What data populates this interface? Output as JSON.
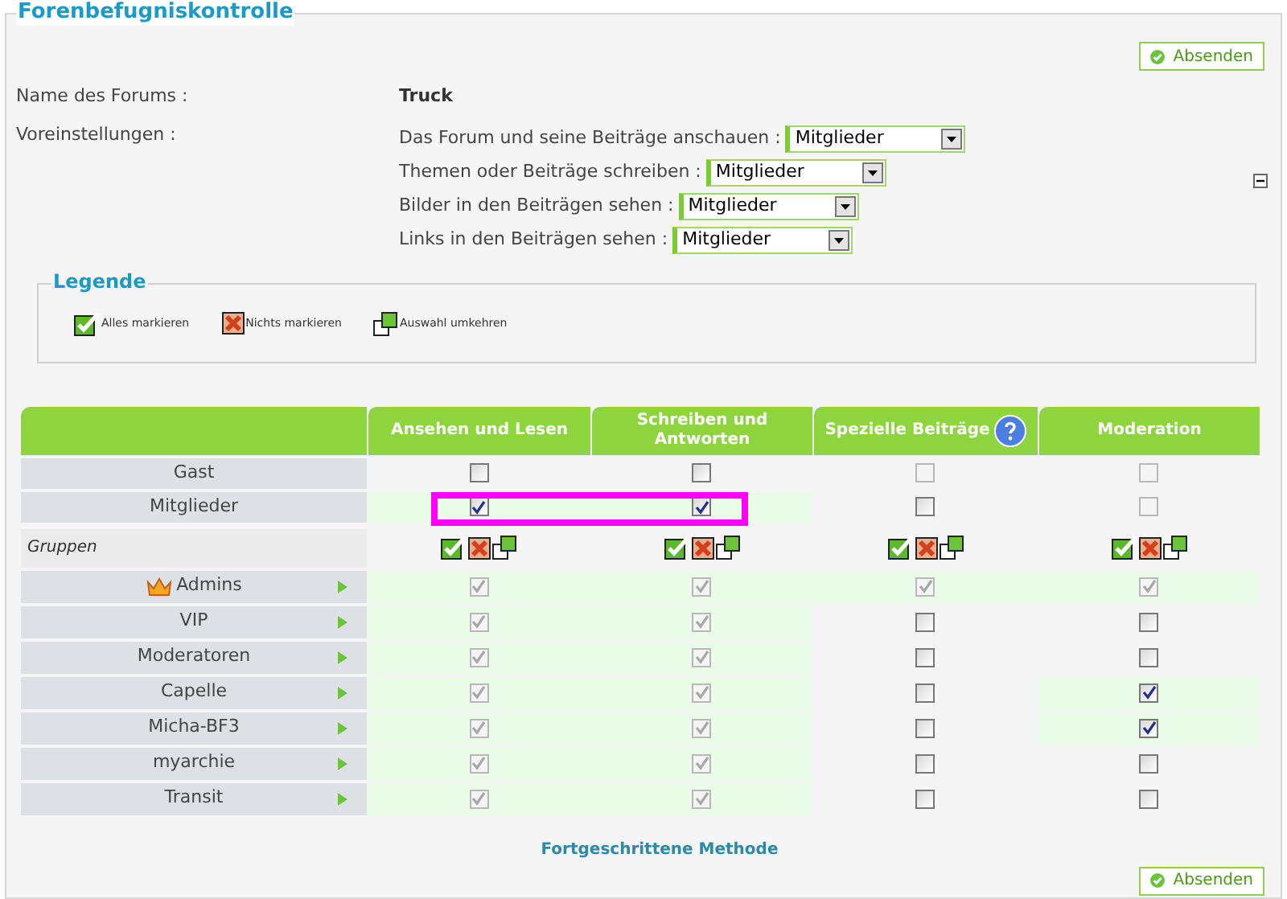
{
  "title": "Forenbefugniskontrolle",
  "submit_top": "Absenden",
  "forum_name": {
    "label": "Name des Forums :",
    "value": "Truck"
  },
  "presets": {
    "label": "Voreinstellungen :",
    "items": [
      {
        "label": "Das Forum und seine Beiträge anschauen :",
        "value": "Mitglieder"
      },
      {
        "label": "Themen oder Beiträge schreiben :",
        "value": "Mitglieder"
      },
      {
        "label": "Bilder in den Beiträgen sehen :",
        "value": "Mitglieder"
      },
      {
        "label": "Links in den Beiträgen sehen :",
        "value": "Mitglieder"
      }
    ]
  },
  "legend": {
    "title": "Legende",
    "items": [
      {
        "kind": "all",
        "label": "Alles markieren"
      },
      {
        "kind": "none",
        "label": "Nichts markieren"
      },
      {
        "kind": "invert",
        "label": "Auswahl umkehren"
      }
    ]
  },
  "table": {
    "columns": [
      {
        "label": "Ansehen und Lesen",
        "help": false
      },
      {
        "label": "Schreiben und Antworten",
        "help": false
      },
      {
        "label": "Spezielle Beiträge",
        "help": true
      },
      {
        "label": "Moderation",
        "help": false
      }
    ],
    "rows": [
      {
        "kind": "user",
        "label": "Gast",
        "highlighted": false,
        "cells": [
          {
            "checked": false,
            "disabled": false
          },
          {
            "checked": false,
            "disabled": false
          },
          {
            "checked": false,
            "disabled": true
          },
          {
            "checked": false,
            "disabled": true
          }
        ]
      },
      {
        "kind": "user",
        "label": "Mitglieder",
        "highlighted": true,
        "cells": [
          {
            "checked": true,
            "disabled": false
          },
          {
            "checked": true,
            "disabled": false
          },
          {
            "checked": false,
            "disabled": false
          },
          {
            "checked": false,
            "disabled": true
          }
        ]
      },
      {
        "kind": "section",
        "label": "Gruppen"
      },
      {
        "kind": "group",
        "label": "Admins",
        "crown": true,
        "highlighted": false,
        "cells": [
          {
            "checked": true,
            "disabled": true
          },
          {
            "checked": true,
            "disabled": true
          },
          {
            "checked": true,
            "disabled": true
          },
          {
            "checked": true,
            "disabled": true
          }
        ]
      },
      {
        "kind": "group",
        "label": "VIP",
        "crown": false,
        "highlighted": false,
        "cells": [
          {
            "checked": true,
            "disabled": true
          },
          {
            "checked": true,
            "disabled": true
          },
          {
            "checked": false,
            "disabled": false
          },
          {
            "checked": false,
            "disabled": false
          }
        ]
      },
      {
        "kind": "group",
        "label": "Moderatoren",
        "crown": false,
        "highlighted": false,
        "cells": [
          {
            "checked": true,
            "disabled": true
          },
          {
            "checked": true,
            "disabled": true
          },
          {
            "checked": false,
            "disabled": false
          },
          {
            "checked": false,
            "disabled": false
          }
        ]
      },
      {
        "kind": "group",
        "label": "Capelle",
        "crown": false,
        "highlighted": false,
        "cells": [
          {
            "checked": true,
            "disabled": true
          },
          {
            "checked": true,
            "disabled": true
          },
          {
            "checked": false,
            "disabled": false
          },
          {
            "checked": true,
            "disabled": false
          }
        ]
      },
      {
        "kind": "group",
        "label": "Micha-BF3",
        "crown": false,
        "highlighted": false,
        "cells": [
          {
            "checked": true,
            "disabled": true
          },
          {
            "checked": true,
            "disabled": true
          },
          {
            "checked": false,
            "disabled": false
          },
          {
            "checked": true,
            "disabled": false
          }
        ]
      },
      {
        "kind": "group",
        "label": "myarchie",
        "crown": false,
        "highlighted": false,
        "cells": [
          {
            "checked": true,
            "disabled": true
          },
          {
            "checked": true,
            "disabled": true
          },
          {
            "checked": false,
            "disabled": false
          },
          {
            "checked": false,
            "disabled": false
          }
        ]
      },
      {
        "kind": "group",
        "label": "Transit",
        "crown": false,
        "highlighted": false,
        "cells": [
          {
            "checked": true,
            "disabled": true
          },
          {
            "checked": true,
            "disabled": true
          },
          {
            "checked": false,
            "disabled": false
          },
          {
            "checked": false,
            "disabled": false
          }
        ]
      }
    ]
  },
  "advanced_link": "Fortgeschrittene Methode",
  "submit_bottom": "Absenden"
}
